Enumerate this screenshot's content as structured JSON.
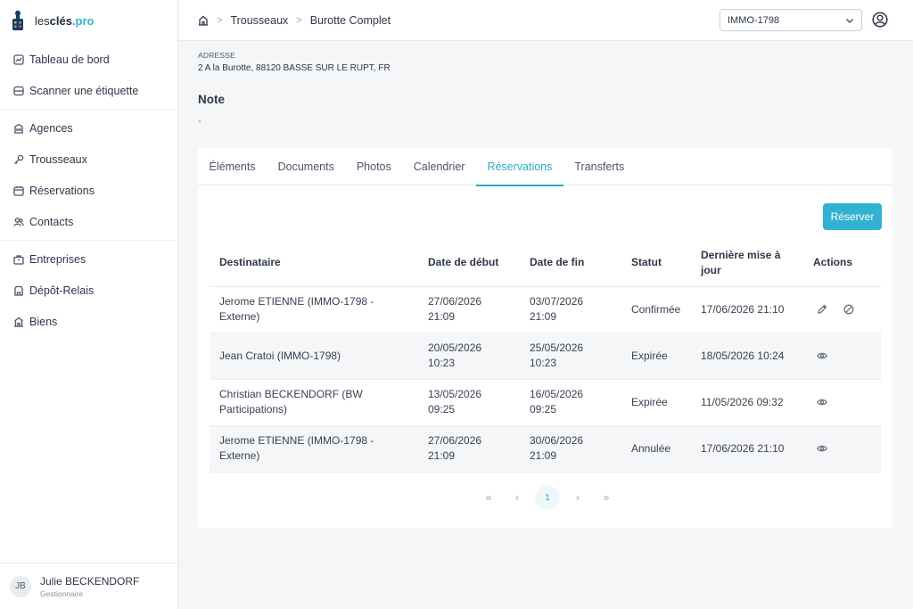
{
  "brand": {
    "part1": "les",
    "part2": "clés",
    "part3": ".pro"
  },
  "sidebar": {
    "groups": [
      [
        {
          "label": "Tableau de bord",
          "icon": "dashboard-icon"
        },
        {
          "label": "Scanner une étiquette",
          "icon": "scan-icon"
        }
      ],
      [
        {
          "label": "Agences",
          "icon": "building-icon"
        },
        {
          "label": "Trousseaux",
          "icon": "key-icon"
        },
        {
          "label": "Réservations",
          "icon": "calendar-icon"
        },
        {
          "label": "Contacts",
          "icon": "contacts-icon"
        }
      ],
      [
        {
          "label": "Entreprises",
          "icon": "briefcase-icon"
        },
        {
          "label": "Dépôt-Relais",
          "icon": "store-icon"
        },
        {
          "label": "Biens",
          "icon": "property-icon"
        }
      ]
    ]
  },
  "user": {
    "initials": "JB",
    "name": "Julie BECKENDORF",
    "role": "Gestionnaire"
  },
  "breadcrumb": {
    "items": [
      "Trousseaux",
      "Burotte Complet"
    ]
  },
  "agency_select": {
    "value": "IMMO-1798"
  },
  "address": {
    "label": "ADRESSE",
    "value": "2 A la Burotte, 88120 BASSE SUR LE RUPT, FR"
  },
  "note": {
    "title": "Note",
    "value": "-"
  },
  "tabs": [
    {
      "label": "Éléments",
      "active": false
    },
    {
      "label": "Documents",
      "active": false
    },
    {
      "label": "Photos",
      "active": false
    },
    {
      "label": "Calendrier",
      "active": false
    },
    {
      "label": "Réservations",
      "active": true
    },
    {
      "label": "Transferts",
      "active": false
    }
  ],
  "reserve_button": "Réserver",
  "table": {
    "headers": [
      "Destinataire",
      "Date de début",
      "Date de fin",
      "Statut",
      "Dernière mise à jour",
      "Actions"
    ],
    "rows": [
      {
        "recipient": "Jerome ETIENNE (IMMO-1798 - Externe)",
        "start": "27/06/2026 21:09",
        "end": "03/07/2026 21:09",
        "status": "Confirmée",
        "updated": "17/06/2026 21:10",
        "actions": [
          "edit-icon",
          "cancel-icon"
        ]
      },
      {
        "recipient": "Jean Cratoi (IMMO-1798)",
        "start": "20/05/2026 10:23",
        "end": "25/05/2026 10:23",
        "status": "Expirée",
        "updated": "18/05/2026 10:24",
        "actions": [
          "view-icon"
        ]
      },
      {
        "recipient": "Christian BECKENDORF (BW Participations)",
        "start": "13/05/2026 09:25",
        "end": "16/05/2026 09:25",
        "status": "Expirée",
        "updated": "11/05/2026 09:32",
        "actions": [
          "view-icon"
        ]
      },
      {
        "recipient": "Jerome ETIENNE (IMMO-1798 - Externe)",
        "start": "27/06/2026 21:09",
        "end": "30/06/2026 21:09",
        "status": "Annulée",
        "updated": "17/06/2026 21:10",
        "actions": [
          "view-icon"
        ]
      }
    ]
  },
  "pagination": {
    "first": "«",
    "prev": "‹",
    "current": "1",
    "next": "›",
    "last": "»"
  }
}
